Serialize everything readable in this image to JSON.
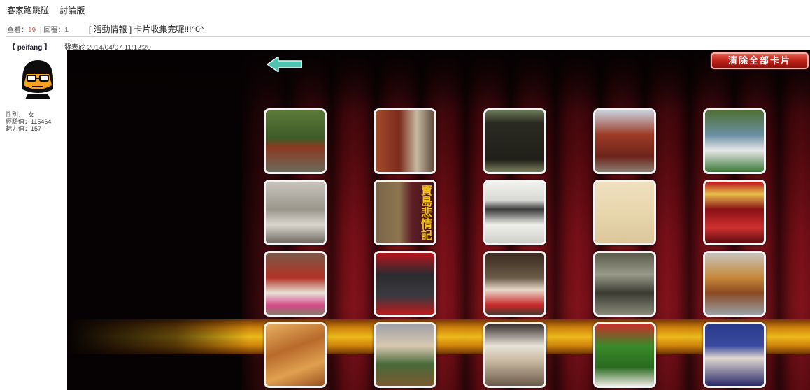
{
  "header": {
    "site_name": "客家跑跳碰",
    "section": "討論版"
  },
  "thread": {
    "views_label": "查看：",
    "views": "19",
    "separator": "|",
    "replies_label": "回覆：",
    "replies": "1",
    "title": "[ 活動情報 ]  卡片收集完囉!!!^0^"
  },
  "post": {
    "author": "【 peifang 】",
    "posted_label": "發表於",
    "posted_at": "2014/04/07 11:12:20"
  },
  "profile": {
    "gender_label": "性別：",
    "gender": "女",
    "exp_label": "經驗值：",
    "exp": "115464",
    "charm_label": "魅力值：",
    "charm": "157"
  },
  "game": {
    "clear_label": "清除全部卡片",
    "cards": [
      [
        "temple-trees",
        "temple-gate",
        "stone-tablet",
        "temple-hall",
        "lion-dance-figure"
      ],
      [
        "stone-sculpture",
        "book-cover",
        "portrait-page",
        "old-paper",
        "temple-plaques"
      ],
      [
        "altar-offerings",
        "shrine",
        "pig-offering",
        "kitchen-pots",
        "dish-stewed"
      ],
      [
        "fried-pastries",
        "food-stall",
        "noodle-bowl",
        "greens-plate",
        "choir-performance"
      ]
    ],
    "card_texts": {
      "book-cover": "寶島悲情記"
    }
  },
  "colors": {
    "accent_red": "#d9534f",
    "button_red": "#b81e16",
    "arrow_teal": "#4fc3b0",
    "curtain_red": "#7a121a",
    "gold_band": "#f4c11c"
  }
}
